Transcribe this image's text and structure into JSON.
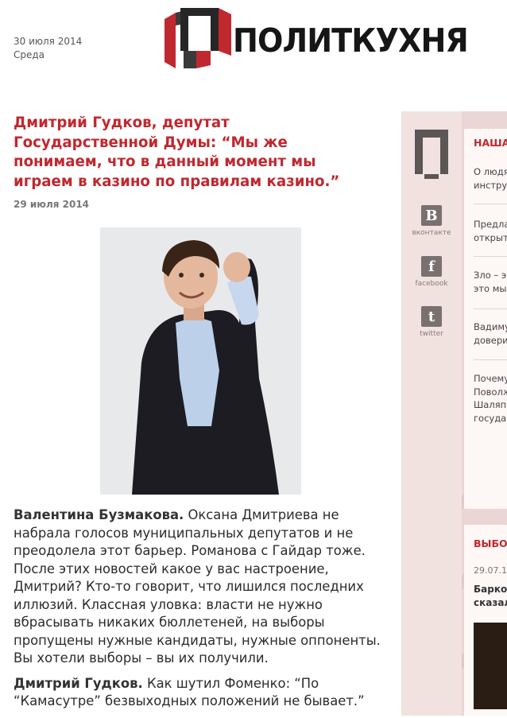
{
  "header": {
    "date": "30 июля 2014",
    "weekday": "Среда",
    "logo_text": "ПОЛИТКУХНЯ",
    "logo_mark": "П"
  },
  "article": {
    "headline": "Дмитрий Гудков, депутат Государственной Думы: “Мы же понимаем, что в данный момент мы играем в казино по правилам казино.”",
    "date": "29 июля 2014",
    "paragraphs": [
      {
        "speaker": "Валентина Бузмакова.",
        "text": " Оксана Дмитриева не набрала голосов муниципальных депутатов и не преодолела этот барьер. Романова с Гайдар тоже. После этих новостей какое у вас настроение, Дмитрий? Кто-то говорит, что лишился последних иллюзий. Классная уловка: власти не нужно вбрасывать никаких бюллетеней, на выборы пропущены нужные кандидаты, нужные оппоненты. Вы хотели выборы – вы их получили."
      },
      {
        "speaker": "Дмитрий Гудков.",
        "text": " Как шутил Фоменко: “По “Камасутре” безвыходных положений не бывает.”"
      }
    ]
  },
  "share": {
    "logo_mark": "П",
    "items": [
      {
        "icon": "vkontakte-icon",
        "glyph": "В",
        "label": "вконтакте"
      },
      {
        "icon": "facebook-icon",
        "glyph": "f",
        "label": "facebook"
      },
      {
        "icon": "twitter-icon",
        "glyph": "t",
        "label": "twitter"
      }
    ]
  },
  "sidebar": {
    "section1_title": "НАША",
    "items": [
      [
        "О людя",
        "инстру"
      ],
      [
        "Предла",
        "открыт"
      ],
      [
        "Зло – э",
        "это мы"
      ],
      [
        "Вадиму",
        "довери"
      ],
      [
        "Почему",
        "Поволж",
        "Шаляпи",
        "государ"
      ]
    ],
    "section2_title": "ВЫБО",
    "item2_date": "29.07.1",
    "item2_text": [
      "Барко",
      "сказал"
    ]
  },
  "colors": {
    "accent": "#c0282f",
    "logo_gray": "#555555",
    "panel_bg": "#ead6d4"
  }
}
